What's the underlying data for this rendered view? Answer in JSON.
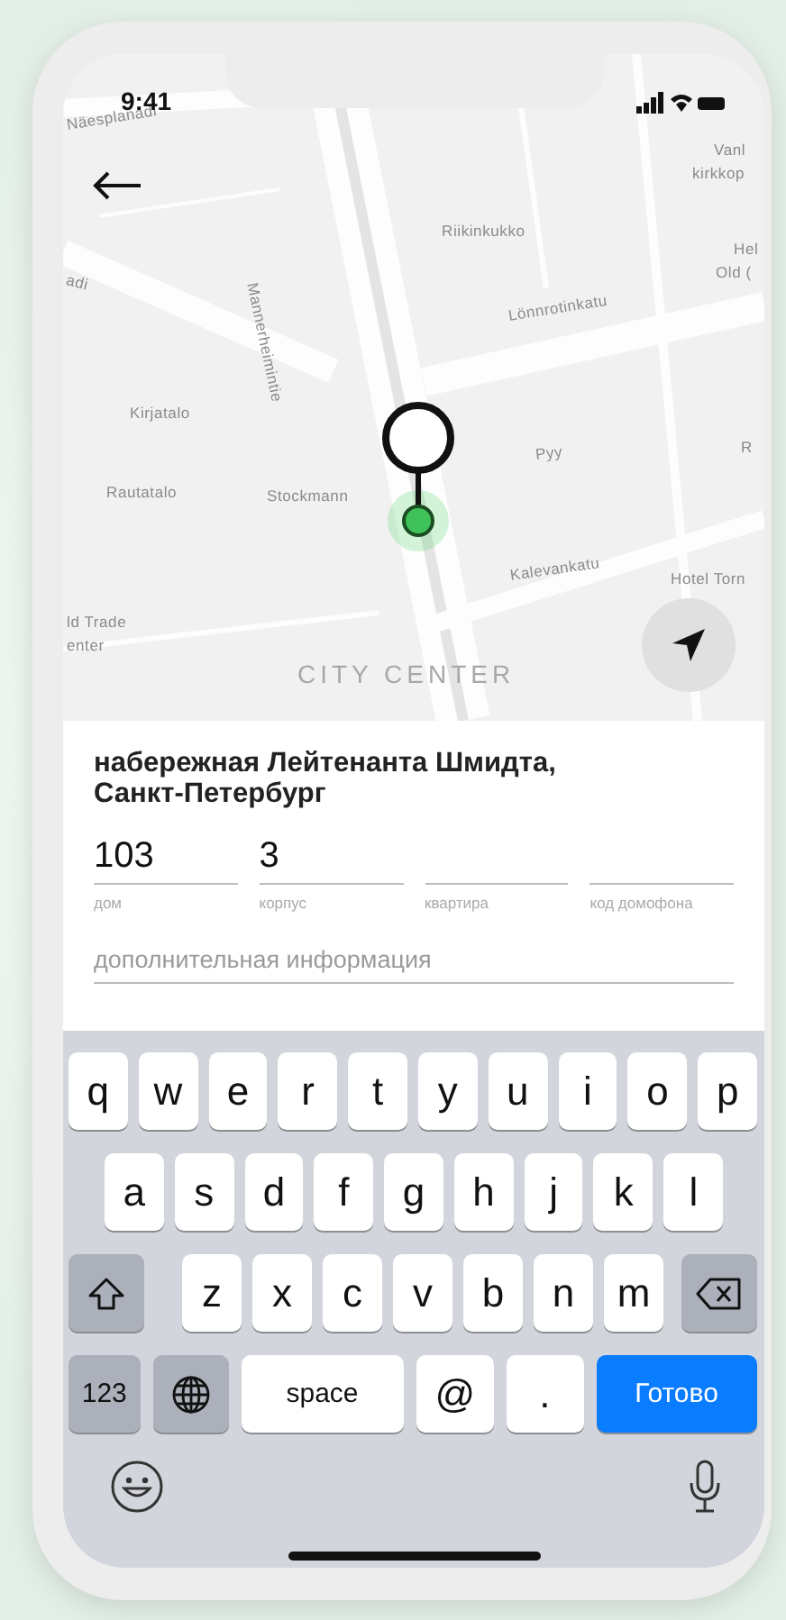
{
  "status_bar": {
    "time": "9:41"
  },
  "map": {
    "labels": [
      {
        "text": "Näesplanadi"
      },
      {
        "text": "Vanl"
      },
      {
        "text": "kirkkop"
      },
      {
        "text": "Riikinkukko"
      },
      {
        "text": "Hel"
      },
      {
        "text": "Old ("
      },
      {
        "text": "adi"
      },
      {
        "text": "Mannerheimintie"
      },
      {
        "text": "Lönnrotinkatu"
      },
      {
        "text": "Kirjatalo"
      },
      {
        "text": "Pyy"
      },
      {
        "text": "R"
      },
      {
        "text": "Rautatalo"
      },
      {
        "text": "Stockmann"
      },
      {
        "text": "Kalevankatu"
      },
      {
        "text": "Hotel Torn"
      },
      {
        "text": "ld Trade"
      },
      {
        "text": "enter"
      },
      {
        "text": "CITY CENTER"
      }
    ]
  },
  "address": {
    "title": "набережная Лейтенанта Шмидта, Санкт-Петербург"
  },
  "fields": [
    {
      "label": "дом",
      "value": "103"
    },
    {
      "label": "корпус",
      "value": "3"
    },
    {
      "label": "квартира"
    },
    {
      "label": "код домофона"
    }
  ],
  "extra_field": {
    "placeholder": "дополнительная информация"
  },
  "keyboard": {
    "top_row": [
      {
        "kind": "letter",
        "label": "q"
      },
      {
        "kind": "letter",
        "label": "w"
      },
      {
        "kind": "letter",
        "label": "e"
      },
      {
        "kind": "letter",
        "label": "r"
      },
      {
        "kind": "letter",
        "label": "t"
      },
      {
        "kind": "letter",
        "label": "y"
      },
      {
        "kind": "letter",
        "label": "u"
      },
      {
        "kind": "letter",
        "label": "i"
      },
      {
        "kind": "letter",
        "label": "o"
      },
      {
        "kind": "letter",
        "label": "p"
      }
    ],
    "middle_row": [
      {
        "kind": "letter",
        "label": "a"
      },
      {
        "kind": "letter",
        "label": "s"
      },
      {
        "kind": "letter",
        "label": "d"
      },
      {
        "kind": "letter",
        "label": "f"
      },
      {
        "kind": "letter",
        "label": "g"
      },
      {
        "kind": "letter",
        "label": "h"
      },
      {
        "kind": "letter",
        "label": "j"
      },
      {
        "kind": "letter",
        "label": "k"
      },
      {
        "kind": "letter",
        "label": "l"
      }
    ],
    "lower_row": [
      {
        "kind": "shift"
      },
      {
        "kind": "letter",
        "label": "z"
      },
      {
        "kind": "letter",
        "label": "x"
      },
      {
        "kind": "letter",
        "label": "c"
      },
      {
        "kind": "letter",
        "label": "v"
      },
      {
        "kind": "letter",
        "label": "b"
      },
      {
        "kind": "letter",
        "label": "n"
      },
      {
        "kind": "letter",
        "label": "m"
      },
      {
        "kind": "backspace"
      }
    ],
    "function_row": [
      {
        "kind": "mode",
        "label": "123"
      },
      {
        "kind": "globe"
      },
      {
        "kind": "space",
        "label": "space"
      },
      {
        "kind": "symbol",
        "label": "@"
      },
      {
        "kind": "symbol",
        "label": "."
      },
      {
        "kind": "done",
        "label": "Готово"
      }
    ]
  }
}
